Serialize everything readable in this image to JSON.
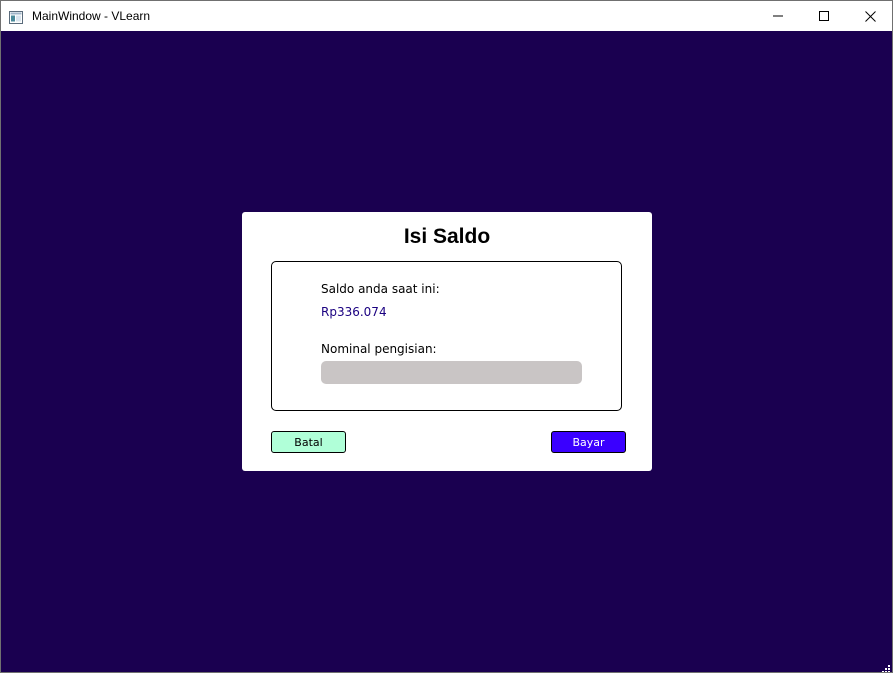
{
  "window": {
    "title": "MainWindow - VLearn",
    "background_color": "#1a0050"
  },
  "titlebar_controls": {
    "minimize_icon": "minimize-icon",
    "maximize_icon": "maximize-icon",
    "close_icon": "close-icon"
  },
  "dialog": {
    "title": "Isi Saldo",
    "balance_label": "Saldo anda saat ini:",
    "balance_value": "Rp336.074",
    "nominal_label": "Nominal pengisian:",
    "nominal_value": "",
    "nominal_placeholder": "",
    "cancel_label": "Batal",
    "pay_label": "Bayar"
  },
  "colors": {
    "cancel_button": "#b0ffd8",
    "pay_button": "#3a00ff",
    "balance_text": "#1a0080",
    "input_background": "#c9c5c5"
  }
}
